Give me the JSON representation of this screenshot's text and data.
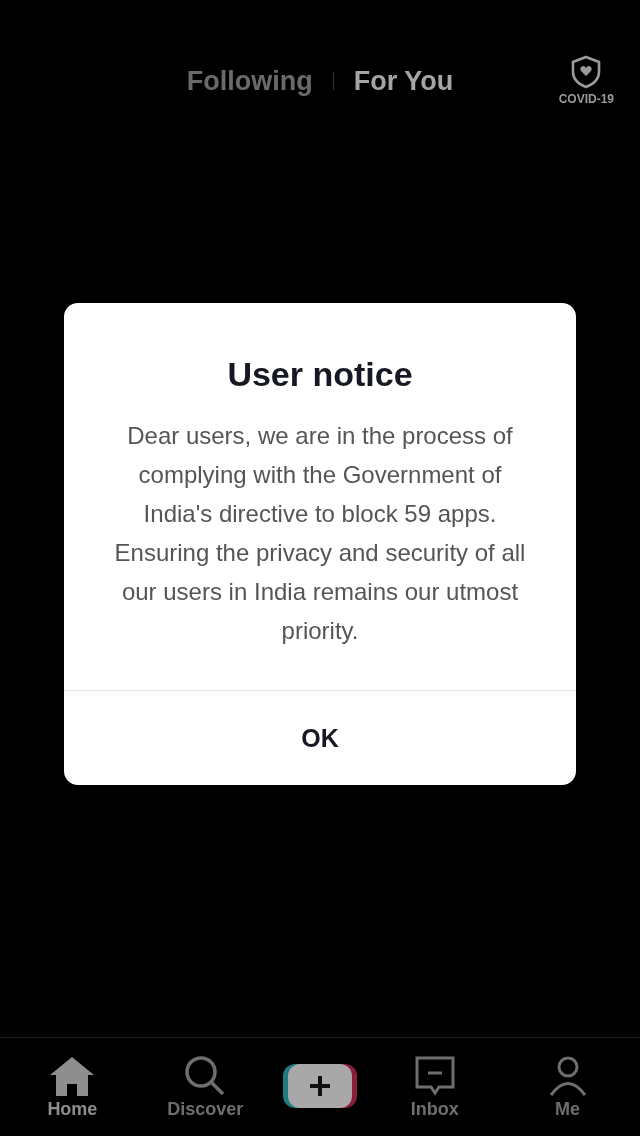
{
  "top_tabs": [
    {
      "label": "Following",
      "selected": false
    },
    {
      "label": "For You",
      "selected": true
    }
  ],
  "covid_badge": {
    "label": "COVID-19"
  },
  "dialog": {
    "title": "User notice",
    "message": "Dear users, we are in the process of complying with the Government of India's directive to block 59 apps. Ensuring the privacy and security of all our users in India remains our utmost priority.",
    "button": "OK"
  },
  "bottom_nav": [
    {
      "kind": "home",
      "label": "Home",
      "selected": true
    },
    {
      "kind": "search",
      "label": "Discover",
      "selected": false
    },
    {
      "kind": "create",
      "selected": false
    },
    {
      "kind": "inbox",
      "label": "Inbox",
      "selected": false
    },
    {
      "kind": "profile",
      "label": "Me",
      "selected": false
    }
  ]
}
